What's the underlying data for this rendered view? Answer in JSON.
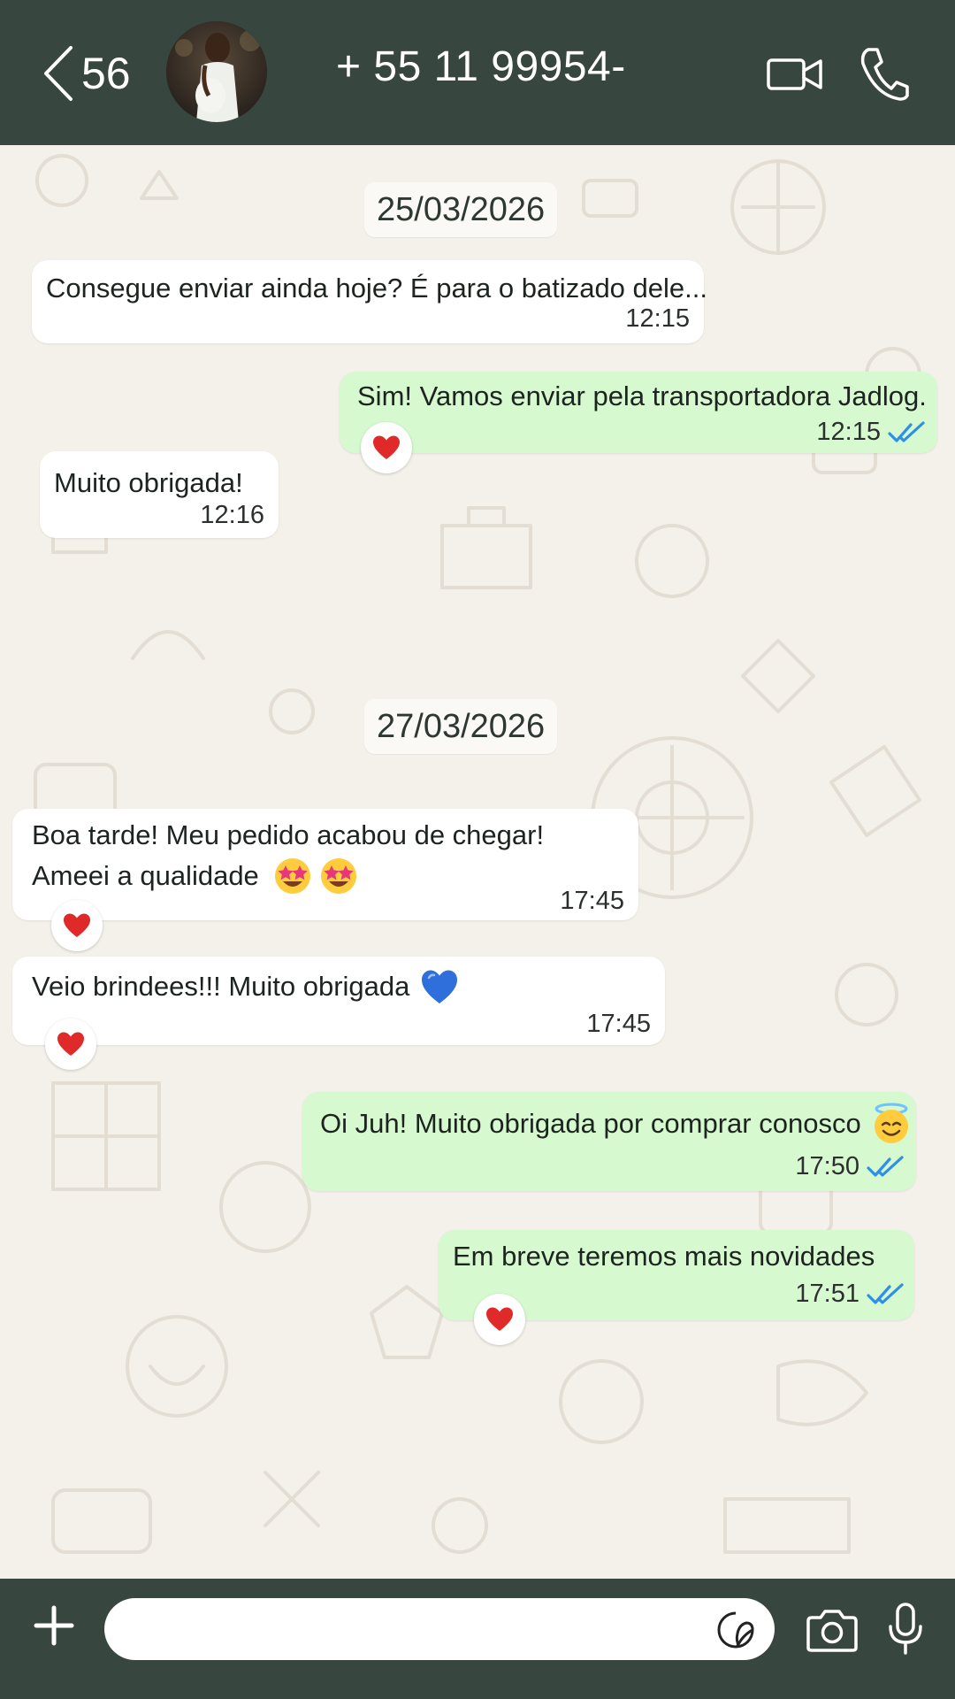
{
  "header": {
    "back_count": "56",
    "contact_name": "+ 55 11 99954-"
  },
  "chat": {
    "dates": [
      "25/03/2026",
      "27/03/2026"
    ],
    "messages": [
      {
        "direction": "in",
        "text": "Consegue enviar ainda hoje? É para o batizado dele...",
        "time": "12:15",
        "reaction": null
      },
      {
        "direction": "out",
        "text": "Sim! Vamos enviar pela transportadora Jadlog.",
        "time": "12:15",
        "status": "read",
        "reaction": "red-heart"
      },
      {
        "direction": "in",
        "text": "Muito obrigada!",
        "time": "12:16",
        "reaction": null
      },
      {
        "direction": "in",
        "text_line1": "Boa tarde! Meu pedido acabou de chegar!",
        "text_line2": "Ameei a qualidade",
        "emojis": [
          "star-struck",
          "star-struck"
        ],
        "time": "17:45",
        "reaction": "red-heart"
      },
      {
        "direction": "in",
        "text": "Veio brindees!!! Muito obrigada",
        "emojis": [
          "blue-heart"
        ],
        "time": "17:45",
        "reaction": "red-heart"
      },
      {
        "direction": "out",
        "text": "Oi Juh! Muito obrigada por comprar conosco",
        "emojis": [
          "smiling-face-with-halo"
        ],
        "time": "17:50",
        "status": "read",
        "reaction": null
      },
      {
        "direction": "out",
        "text": "Em breve teremos mais novidades",
        "time": "17:51",
        "status": "read",
        "reaction": "red-heart"
      }
    ]
  },
  "composer": {
    "placeholder": ""
  },
  "icons": {
    "back": "chevron-left-icon",
    "video": "video-call-icon",
    "phone": "phone-icon",
    "plus": "plus-icon",
    "sticker": "sticker-icon",
    "camera": "camera-icon",
    "mic": "microphone-icon"
  },
  "colors": {
    "header_bg": "#37463f",
    "outgoing_bubble": "#d6f9cf",
    "incoming_bubble": "#ffffff",
    "chat_bg": "#f4f0ea",
    "read_ticks": "#2e8fe8"
  }
}
